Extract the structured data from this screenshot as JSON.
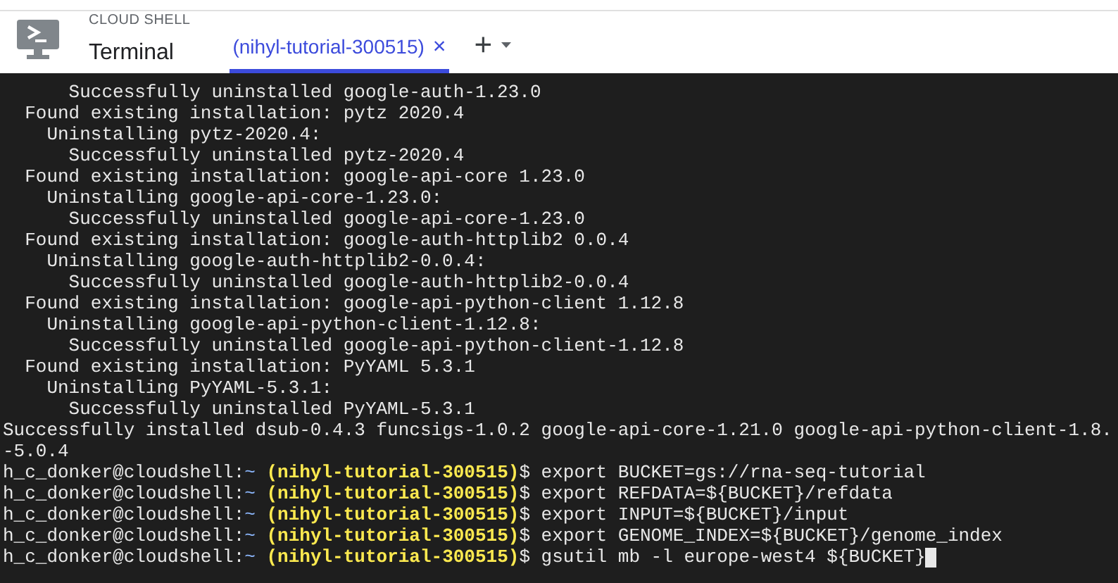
{
  "header": {
    "product": "CLOUD SHELL",
    "title": "Terminal",
    "tabs": [
      {
        "label": "(nihyl-tutorial-300515)",
        "selected": true,
        "close": "×"
      }
    ],
    "add": "+"
  },
  "terminal": {
    "lines": [
      {
        "kind": "output",
        "text": "      Successfully uninstalled google-auth-1.23.0"
      },
      {
        "kind": "output",
        "text": "  Found existing installation: pytz 2020.4"
      },
      {
        "kind": "output",
        "text": "    Uninstalling pytz-2020.4:"
      },
      {
        "kind": "output",
        "text": "      Successfully uninstalled pytz-2020.4"
      },
      {
        "kind": "output",
        "text": "  Found existing installation: google-api-core 1.23.0"
      },
      {
        "kind": "output",
        "text": "    Uninstalling google-api-core-1.23.0:"
      },
      {
        "kind": "output",
        "text": "      Successfully uninstalled google-api-core-1.23.0"
      },
      {
        "kind": "output",
        "text": "  Found existing installation: google-auth-httplib2 0.0.4"
      },
      {
        "kind": "output",
        "text": "    Uninstalling google-auth-httplib2-0.0.4:"
      },
      {
        "kind": "output",
        "text": "      Successfully uninstalled google-auth-httplib2-0.0.4"
      },
      {
        "kind": "output",
        "text": "  Found existing installation: google-api-python-client 1.12.8"
      },
      {
        "kind": "output",
        "text": "    Uninstalling google-api-python-client-1.12.8:"
      },
      {
        "kind": "output",
        "text": "      Successfully uninstalled google-api-python-client-1.12.8"
      },
      {
        "kind": "output",
        "text": "  Found existing installation: PyYAML 5.3.1"
      },
      {
        "kind": "output",
        "text": "    Uninstalling PyYAML-5.3.1:"
      },
      {
        "kind": "output",
        "text": "      Successfully uninstalled PyYAML-5.3.1"
      },
      {
        "kind": "output",
        "text": "Successfully installed dsub-0.4.3 funcsigs-1.0.2 google-api-core-1.21.0 google-api-python-client-1.8."
      },
      {
        "kind": "output",
        "text": "-5.0.4"
      },
      {
        "kind": "prompt",
        "user": "h_c_donker@cloudshell:",
        "path": "~",
        "project": "(nihyl-tutorial-300515)",
        "symbol": "$",
        "command": "export BUCKET=gs://rna-seq-tutorial",
        "cursor": false
      },
      {
        "kind": "prompt",
        "user": "h_c_donker@cloudshell:",
        "path": "~",
        "project": "(nihyl-tutorial-300515)",
        "symbol": "$",
        "command": "export REFDATA=${BUCKET}/refdata",
        "cursor": false
      },
      {
        "kind": "prompt",
        "user": "h_c_donker@cloudshell:",
        "path": "~",
        "project": "(nihyl-tutorial-300515)",
        "symbol": "$",
        "command": "export INPUT=${BUCKET}/input",
        "cursor": false
      },
      {
        "kind": "prompt",
        "user": "h_c_donker@cloudshell:",
        "path": "~",
        "project": "(nihyl-tutorial-300515)",
        "symbol": "$",
        "command": "export GENOME_INDEX=${BUCKET}/genome_index",
        "cursor": false
      },
      {
        "kind": "prompt",
        "user": "h_c_donker@cloudshell:",
        "path": "~",
        "project": "(nihyl-tutorial-300515)",
        "symbol": "$",
        "command": "gsutil mb -l europe-west4 ${BUCKET}",
        "cursor": true
      }
    ]
  }
}
